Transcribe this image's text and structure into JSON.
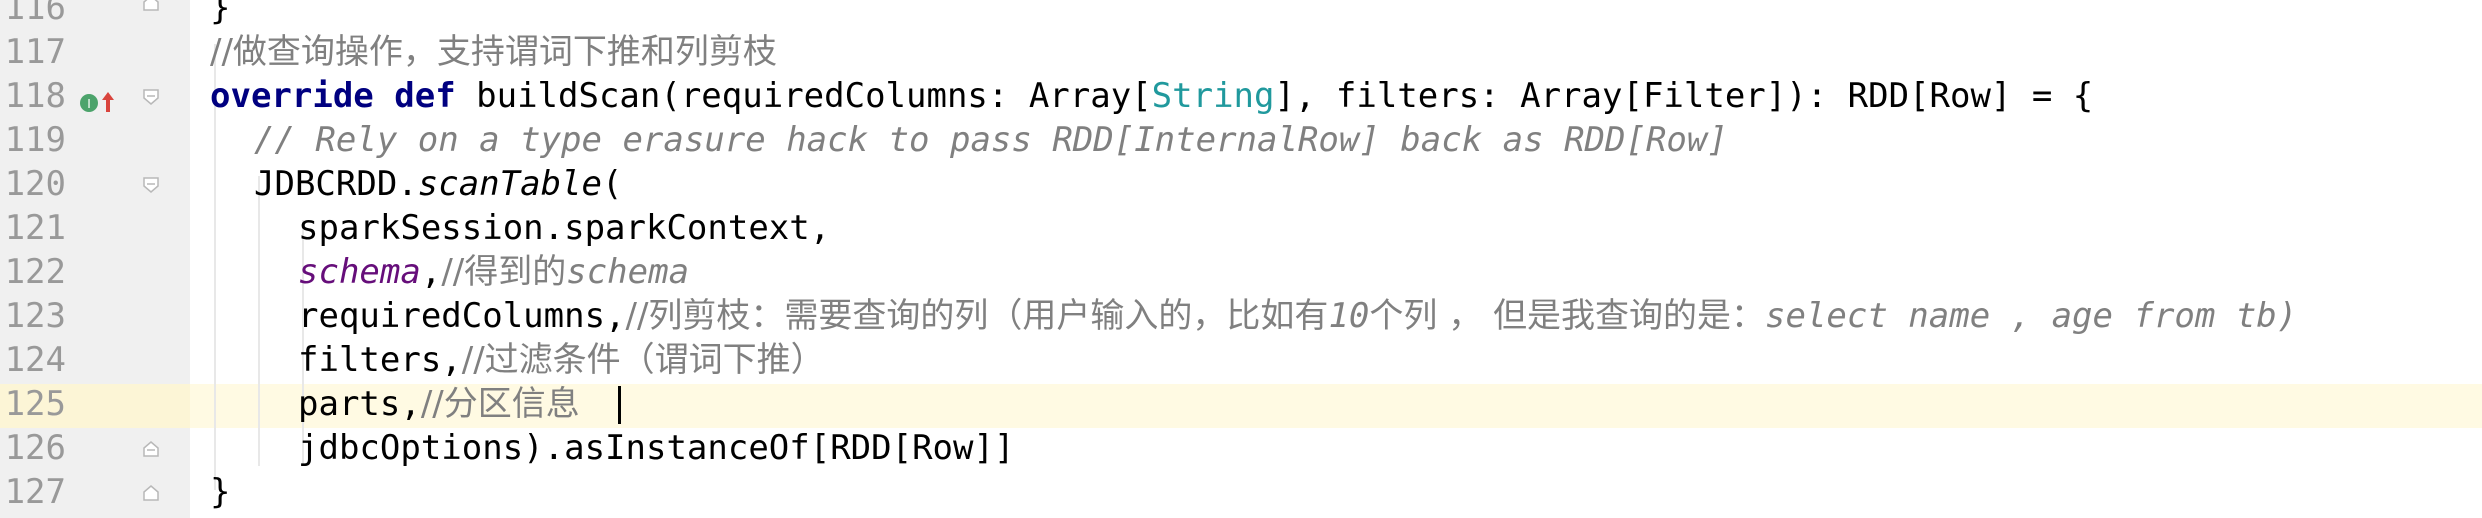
{
  "line_numbers": [
    "116",
    "117",
    "118",
    "119",
    "120",
    "121",
    "122",
    "123",
    "124",
    "125",
    "126",
    "127"
  ],
  "current_line": "125",
  "code": {
    "l116_brace": "}",
    "l117_comment": "//做查询操作，支持谓词下推和列剪枝",
    "l118_kw_override": "override",
    "l118_kw_def": "def",
    "l118_name": " buildScan(requiredColumns: Array[",
    "l118_type_string": "String",
    "l118_rest": "], filters: Array[Filter]): RDD[Row] = {",
    "l119_comment": "// Rely on a type erasure hack to pass RDD[InternalRow] back as RDD[Row]",
    "l120_obj": "JDBCRDD.",
    "l120_method": "scanTable",
    "l120_paren": "(",
    "l121_text": "sparkSession.sparkContext,",
    "l122_schema": "schema",
    "l122_comma": ",",
    "l122_comment_prefix": "//得到的",
    "l122_comment_word": "schema",
    "l123_text": "requiredColumns,",
    "l123_comment_a": "//列剪枝：需要查询的列（用户输入的，比如有",
    "l123_comment_num": "10",
    "l123_comment_b": "个列 ， 但是我查询的是：",
    "l123_comment_sql": "select name , age from tb)",
    "l124_text": "filters,",
    "l124_comment": "//过滤条件（谓词下推）",
    "l125_text": "parts,",
    "l125_comment": "//分区信息",
    "l126_text": "jdbcOptions).asInstanceOf[RDD[Row]]",
    "l127_brace": "}"
  },
  "colors": {
    "keyword": "#000080",
    "type": "#20999d",
    "comment": "#808080",
    "field": "#660e7a",
    "current_line": "#fffae3",
    "gutter": "#f0f0f0"
  },
  "icons": [
    "implements-method-icon",
    "fold-icon"
  ]
}
